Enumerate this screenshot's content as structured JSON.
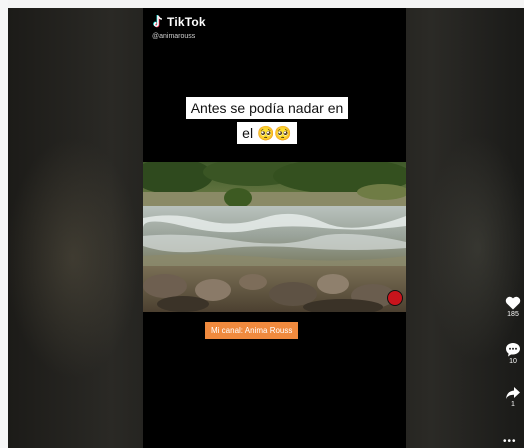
{
  "app": {
    "brand": "TikTok",
    "handle": "@animarouss"
  },
  "caption": {
    "line1": "Antes se podía nadar en",
    "line2": "el 🥺🥺"
  },
  "video": {
    "scene": "river-rapids",
    "watermark_icon": "channel-logo-icon"
  },
  "overlay_tag": {
    "text": "Mi canal: Anima Rouss"
  },
  "actions": {
    "like_count": "185",
    "comment_count": "10",
    "share_count": "1"
  },
  "colors": {
    "accent_orange": "#f08a3e",
    "background": "#000000",
    "caption_bg": "#ffffff"
  }
}
